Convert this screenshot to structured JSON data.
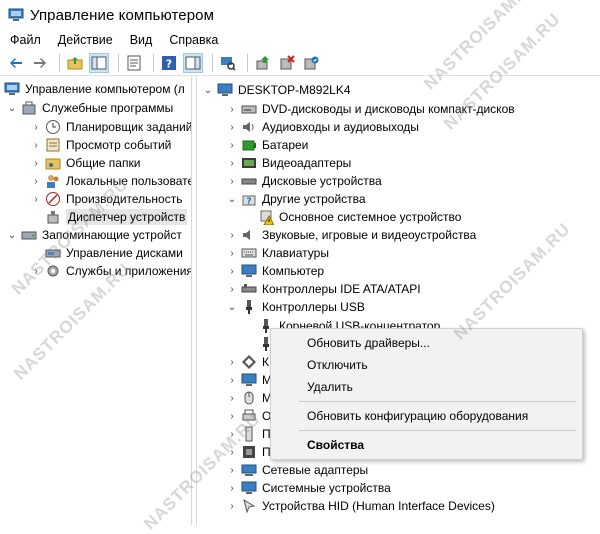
{
  "window": {
    "title": "Управление компьютером"
  },
  "menu": [
    "Файл",
    "Действие",
    "Вид",
    "Справка"
  ],
  "left_tree": [
    {
      "label": "Управление компьютером (л"
    },
    {
      "label": "Служебные программы"
    },
    {
      "label": "Планировщик заданий"
    },
    {
      "label": "Просмотр событий"
    },
    {
      "label": "Общие папки"
    },
    {
      "label": "Локальные пользовате"
    },
    {
      "label": "Производительность"
    },
    {
      "label": "Диспетчер устройств"
    },
    {
      "label": "Запоминающие устройст"
    },
    {
      "label": "Управление дисками"
    },
    {
      "label": "Службы и приложения"
    }
  ],
  "right_tree": [
    {
      "label": "DESKTOP-M892LK4"
    },
    {
      "label": "DVD-дисководы и дисководы компакт-дисков"
    },
    {
      "label": "Аудиовходы и аудиовыходы"
    },
    {
      "label": "Батареи"
    },
    {
      "label": "Видеоадаптеры"
    },
    {
      "label": "Дисковые устройства"
    },
    {
      "label": "Другие устройства"
    },
    {
      "label": "Основное системное устройство"
    },
    {
      "label": "Звуковые, игровые и видеоустройства"
    },
    {
      "label": "Клавиатуры"
    },
    {
      "label": "Компьютер"
    },
    {
      "label": "Контроллеры IDE ATA/ATAPI"
    },
    {
      "label": "Контроллеры USB"
    },
    {
      "label": "Корневой USB-концентратор"
    },
    {
      "label": "К"
    },
    {
      "label": "М"
    },
    {
      "label": "М"
    },
    {
      "label": "О"
    },
    {
      "label": "П"
    },
    {
      "label": "П"
    },
    {
      "label": "Сетевые адаптеры"
    },
    {
      "label": "Системные устройства"
    },
    {
      "label": "Устройства HID (Human Interface Devices)"
    }
  ],
  "context_menu": {
    "items": [
      "Обновить драйверы...",
      "Отключить",
      "Удалить",
      "Обновить конфигурацию оборудования",
      "Свойства"
    ]
  },
  "watermarks": [
    "NASTROISAM.RU",
    "NASTROISAM.RU",
    "NASTROISAM.RU",
    "NASTROISAM.RU",
    "NASTROISAM.RU",
    "NASTROISAM.RU"
  ],
  "icons": {
    "app": "computer-management-icon",
    "colors": {
      "accent": "#1e73be",
      "selection": "#cce4f7",
      "warning": "#f5c400"
    }
  }
}
